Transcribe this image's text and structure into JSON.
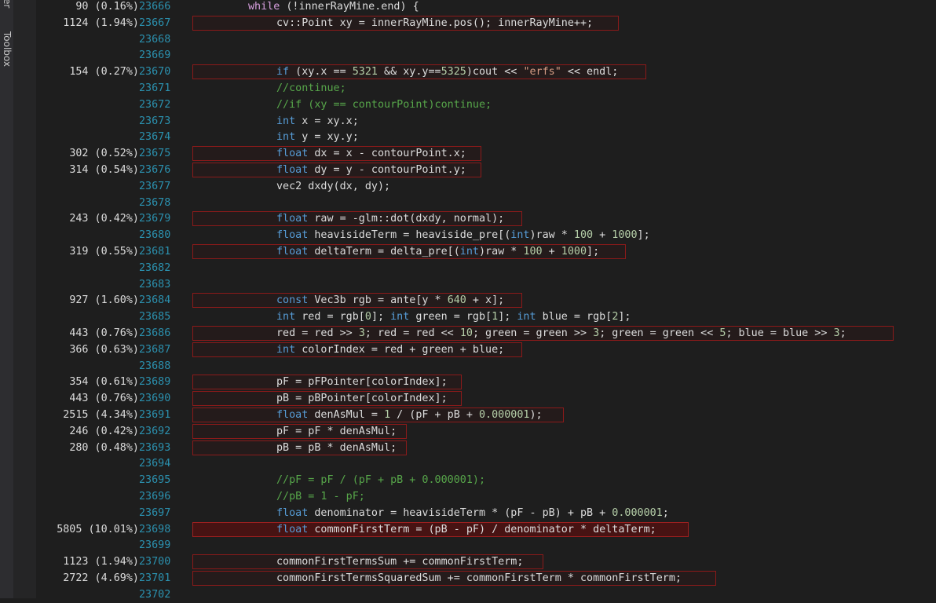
{
  "side_tabs": {
    "explorer": "orer",
    "toolbox": "Toolbox"
  },
  "colors": {
    "background": "#1e1e1e",
    "line_number": "#2b91af",
    "keyword": "#569cd6",
    "comment": "#57a64a",
    "string": "#d69d85",
    "number": "#b5cea8",
    "hot_border": "#8b1a1a"
  },
  "lines": [
    {
      "perf": "90 (0.16%)",
      "ln": "23666",
      "hot": false,
      "hot_width": 315,
      "indent": 0,
      "tokens": [
        [
          "ctl",
          "while"
        ],
        [
          "p",
          " (!innerRayMine.end) {"
        ]
      ]
    },
    {
      "perf": "1124 (1.94%)",
      "ln": "23667",
      "hot": true,
      "hot_width": 543,
      "indent": 1,
      "tokens": [
        [
          "p",
          "cv::Point xy = innerRayMine.pos(); innerRayMine++;"
        ]
      ]
    },
    {
      "perf": "",
      "ln": "23668",
      "indent": 1,
      "tokens": []
    },
    {
      "perf": "",
      "ln": "23669",
      "indent": 1,
      "tokens": []
    },
    {
      "perf": "154 (0.27%)",
      "ln": "23670",
      "hot": true,
      "hot_width": 578,
      "indent": 1,
      "tokens": [
        [
          "kw",
          "if"
        ],
        [
          "p",
          " (xy.x == "
        ],
        [
          "num",
          "5321"
        ],
        [
          "p",
          " && xy.y=="
        ],
        [
          "num",
          "5325"
        ],
        [
          "p",
          ")cout << "
        ],
        [
          "str",
          "\"erfs\""
        ],
        [
          "p",
          " << endl;"
        ]
      ]
    },
    {
      "perf": "",
      "ln": "23671",
      "indent": 1,
      "tokens": [
        [
          "cmt",
          "//continue;"
        ]
      ]
    },
    {
      "perf": "",
      "ln": "23672",
      "indent": 1,
      "tokens": [
        [
          "cmt",
          "//if (xy == contourPoint)continue;"
        ]
      ]
    },
    {
      "perf": "",
      "ln": "23673",
      "indent": 1,
      "tokens": [
        [
          "kw",
          "int"
        ],
        [
          "p",
          " x = xy.x;"
        ]
      ]
    },
    {
      "perf": "",
      "ln": "23674",
      "indent": 1,
      "tokens": [
        [
          "kw",
          "int"
        ],
        [
          "p",
          " y = xy.y;"
        ]
      ]
    },
    {
      "perf": "302 (0.52%)",
      "ln": "23675",
      "hot": true,
      "hot_width": 368,
      "indent": 1,
      "tokens": [
        [
          "kw",
          "float"
        ],
        [
          "p",
          " dx = x - contourPoint.x;"
        ]
      ]
    },
    {
      "perf": "314 (0.54%)",
      "ln": "23676",
      "hot": true,
      "hot_width": 368,
      "indent": 1,
      "tokens": [
        [
          "kw",
          "float"
        ],
        [
          "p",
          " dy = y - contourPoint.y;"
        ]
      ]
    },
    {
      "perf": "",
      "ln": "23677",
      "indent": 1,
      "tokens": [
        [
          "p",
          "vec2 dxdy(dx, dy);"
        ]
      ]
    },
    {
      "perf": "",
      "ln": "23678",
      "indent": 1,
      "tokens": []
    },
    {
      "perf": "243 (0.42%)",
      "ln": "23679",
      "hot": true,
      "hot_width": 420,
      "indent": 1,
      "tokens": [
        [
          "kw",
          "float"
        ],
        [
          "p",
          " raw = -glm::dot(dxdy, normal);"
        ]
      ]
    },
    {
      "perf": "",
      "ln": "23680",
      "indent": 1,
      "tokens": [
        [
          "kw",
          "float"
        ],
        [
          "p",
          " heavisideTerm = heaviside_pre[("
        ],
        [
          "kw",
          "int"
        ],
        [
          "p",
          ")raw * "
        ],
        [
          "num",
          "100"
        ],
        [
          "p",
          " + "
        ],
        [
          "num",
          "1000"
        ],
        [
          "p",
          "];"
        ]
      ]
    },
    {
      "perf": "319 (0.55%)",
      "ln": "23681",
      "hot": true,
      "hot_width": 552,
      "indent": 1,
      "tokens": [
        [
          "kw",
          "float"
        ],
        [
          "p",
          " deltaTerm = delta_pre[("
        ],
        [
          "kw",
          "int"
        ],
        [
          "p",
          ")raw * "
        ],
        [
          "num",
          "100"
        ],
        [
          "p",
          " + "
        ],
        [
          "num",
          "1000"
        ],
        [
          "p",
          "];"
        ]
      ]
    },
    {
      "perf": "",
      "ln": "23682",
      "indent": 1,
      "tokens": []
    },
    {
      "perf": "",
      "ln": "23683",
      "indent": 1,
      "tokens": []
    },
    {
      "perf": "927 (1.60%)",
      "ln": "23684",
      "hot": true,
      "hot_width": 420,
      "indent": 1,
      "tokens": [
        [
          "kw",
          "const"
        ],
        [
          "p",
          " Vec3b rgb = ante[y * "
        ],
        [
          "num",
          "640"
        ],
        [
          "p",
          " + x];"
        ]
      ]
    },
    {
      "perf": "",
      "ln": "23685",
      "indent": 1,
      "tokens": [
        [
          "kw",
          "int"
        ],
        [
          "p",
          " red = rgb["
        ],
        [
          "num",
          "0"
        ],
        [
          "p",
          "]; "
        ],
        [
          "kw",
          "int"
        ],
        [
          "p",
          " green = rgb["
        ],
        [
          "num",
          "1"
        ],
        [
          "p",
          "]; "
        ],
        [
          "kw",
          "int"
        ],
        [
          "p",
          " blue = rgb["
        ],
        [
          "num",
          "2"
        ],
        [
          "p",
          "];"
        ]
      ]
    },
    {
      "perf": "443 (0.76%)",
      "ln": "23686",
      "hot": true,
      "hot_width": 893,
      "indent": 1,
      "tokens": [
        [
          "p",
          "red = red >> "
        ],
        [
          "num",
          "3"
        ],
        [
          "p",
          "; red = red << "
        ],
        [
          "num",
          "10"
        ],
        [
          "p",
          "; green = green >> "
        ],
        [
          "num",
          "3"
        ],
        [
          "p",
          "; green = green << "
        ],
        [
          "num",
          "5"
        ],
        [
          "p",
          "; blue = blue >> "
        ],
        [
          "num",
          "3"
        ],
        [
          "p",
          ";"
        ]
      ]
    },
    {
      "perf": "366 (0.63%)",
      "ln": "23687",
      "hot": true,
      "hot_width": 420,
      "indent": 1,
      "tokens": [
        [
          "kw",
          "int"
        ],
        [
          "p",
          " colorIndex = red + green + blue;"
        ]
      ]
    },
    {
      "perf": "",
      "ln": "23688",
      "indent": 1,
      "tokens": []
    },
    {
      "perf": "354 (0.61%)",
      "ln": "23689",
      "hot": true,
      "hot_width": 343,
      "indent": 1,
      "tokens": [
        [
          "p",
          "pF = pFPointer[colorIndex];"
        ]
      ]
    },
    {
      "perf": "443 (0.76%)",
      "ln": "23690",
      "hot": true,
      "hot_width": 343,
      "indent": 1,
      "tokens": [
        [
          "p",
          "pB = pBPointer[colorIndex];"
        ]
      ]
    },
    {
      "perf": "2515 (4.34%)",
      "ln": "23691",
      "hot": true,
      "hot_width": 473,
      "indent": 1,
      "tokens": [
        [
          "kw",
          "float"
        ],
        [
          "p",
          " denAsMul = "
        ],
        [
          "num",
          "1"
        ],
        [
          "p",
          " / (pF + pB + "
        ],
        [
          "num",
          "0.000001"
        ],
        [
          "p",
          ");"
        ]
      ]
    },
    {
      "perf": "246 (0.42%)",
      "ln": "23692",
      "hot": true,
      "hot_width": 273,
      "indent": 1,
      "tokens": [
        [
          "p",
          "pF = pF * denAsMul;"
        ]
      ]
    },
    {
      "perf": "280 (0.48%)",
      "ln": "23693",
      "hot": true,
      "hot_width": 273,
      "indent": 1,
      "tokens": [
        [
          "p",
          "pB = pB * denAsMul;"
        ]
      ]
    },
    {
      "perf": "",
      "ln": "23694",
      "indent": 1,
      "tokens": []
    },
    {
      "perf": "",
      "ln": "23695",
      "indent": 1,
      "tokens": [
        [
          "cmt",
          "//pF = pF / (pF + pB + 0.000001);"
        ]
      ]
    },
    {
      "perf": "",
      "ln": "23696",
      "indent": 1,
      "tokens": [
        [
          "cmt",
          "//pB = 1 - pF;"
        ]
      ]
    },
    {
      "perf": "",
      "ln": "23697",
      "indent": 1,
      "tokens": [
        [
          "kw",
          "float"
        ],
        [
          "p",
          " denominator = heavisideTerm * (pF - pB) + pB + "
        ],
        [
          "num",
          "0.000001"
        ],
        [
          "p",
          ";"
        ]
      ]
    },
    {
      "perf": "5805 (10.01%)",
      "ln": "23698",
      "hot": true,
      "strong": true,
      "hot_width": 632,
      "indent": 1,
      "tokens": [
        [
          "kw",
          "float"
        ],
        [
          "p",
          " commonFirstTerm = (pB - pF) / denominator * deltaTerm;"
        ]
      ]
    },
    {
      "perf": "",
      "ln": "23699",
      "indent": 1,
      "tokens": []
    },
    {
      "perf": "1123 (1.94%)",
      "ln": "23700",
      "hot": true,
      "hot_width": 447,
      "indent": 1,
      "tokens": [
        [
          "p",
          "commonFirstTermsSum += commonFirstTerm;"
        ]
      ]
    },
    {
      "perf": "2722 (4.69%)",
      "ln": "23701",
      "hot": true,
      "hot_width": 667,
      "indent": 1,
      "tokens": [
        [
          "p",
          "commonFirstTermsSquaredSum += commonFirstTerm * commonFirstTerm;"
        ]
      ]
    },
    {
      "perf": "",
      "ln": "23702",
      "indent": 1,
      "tokens": []
    }
  ]
}
